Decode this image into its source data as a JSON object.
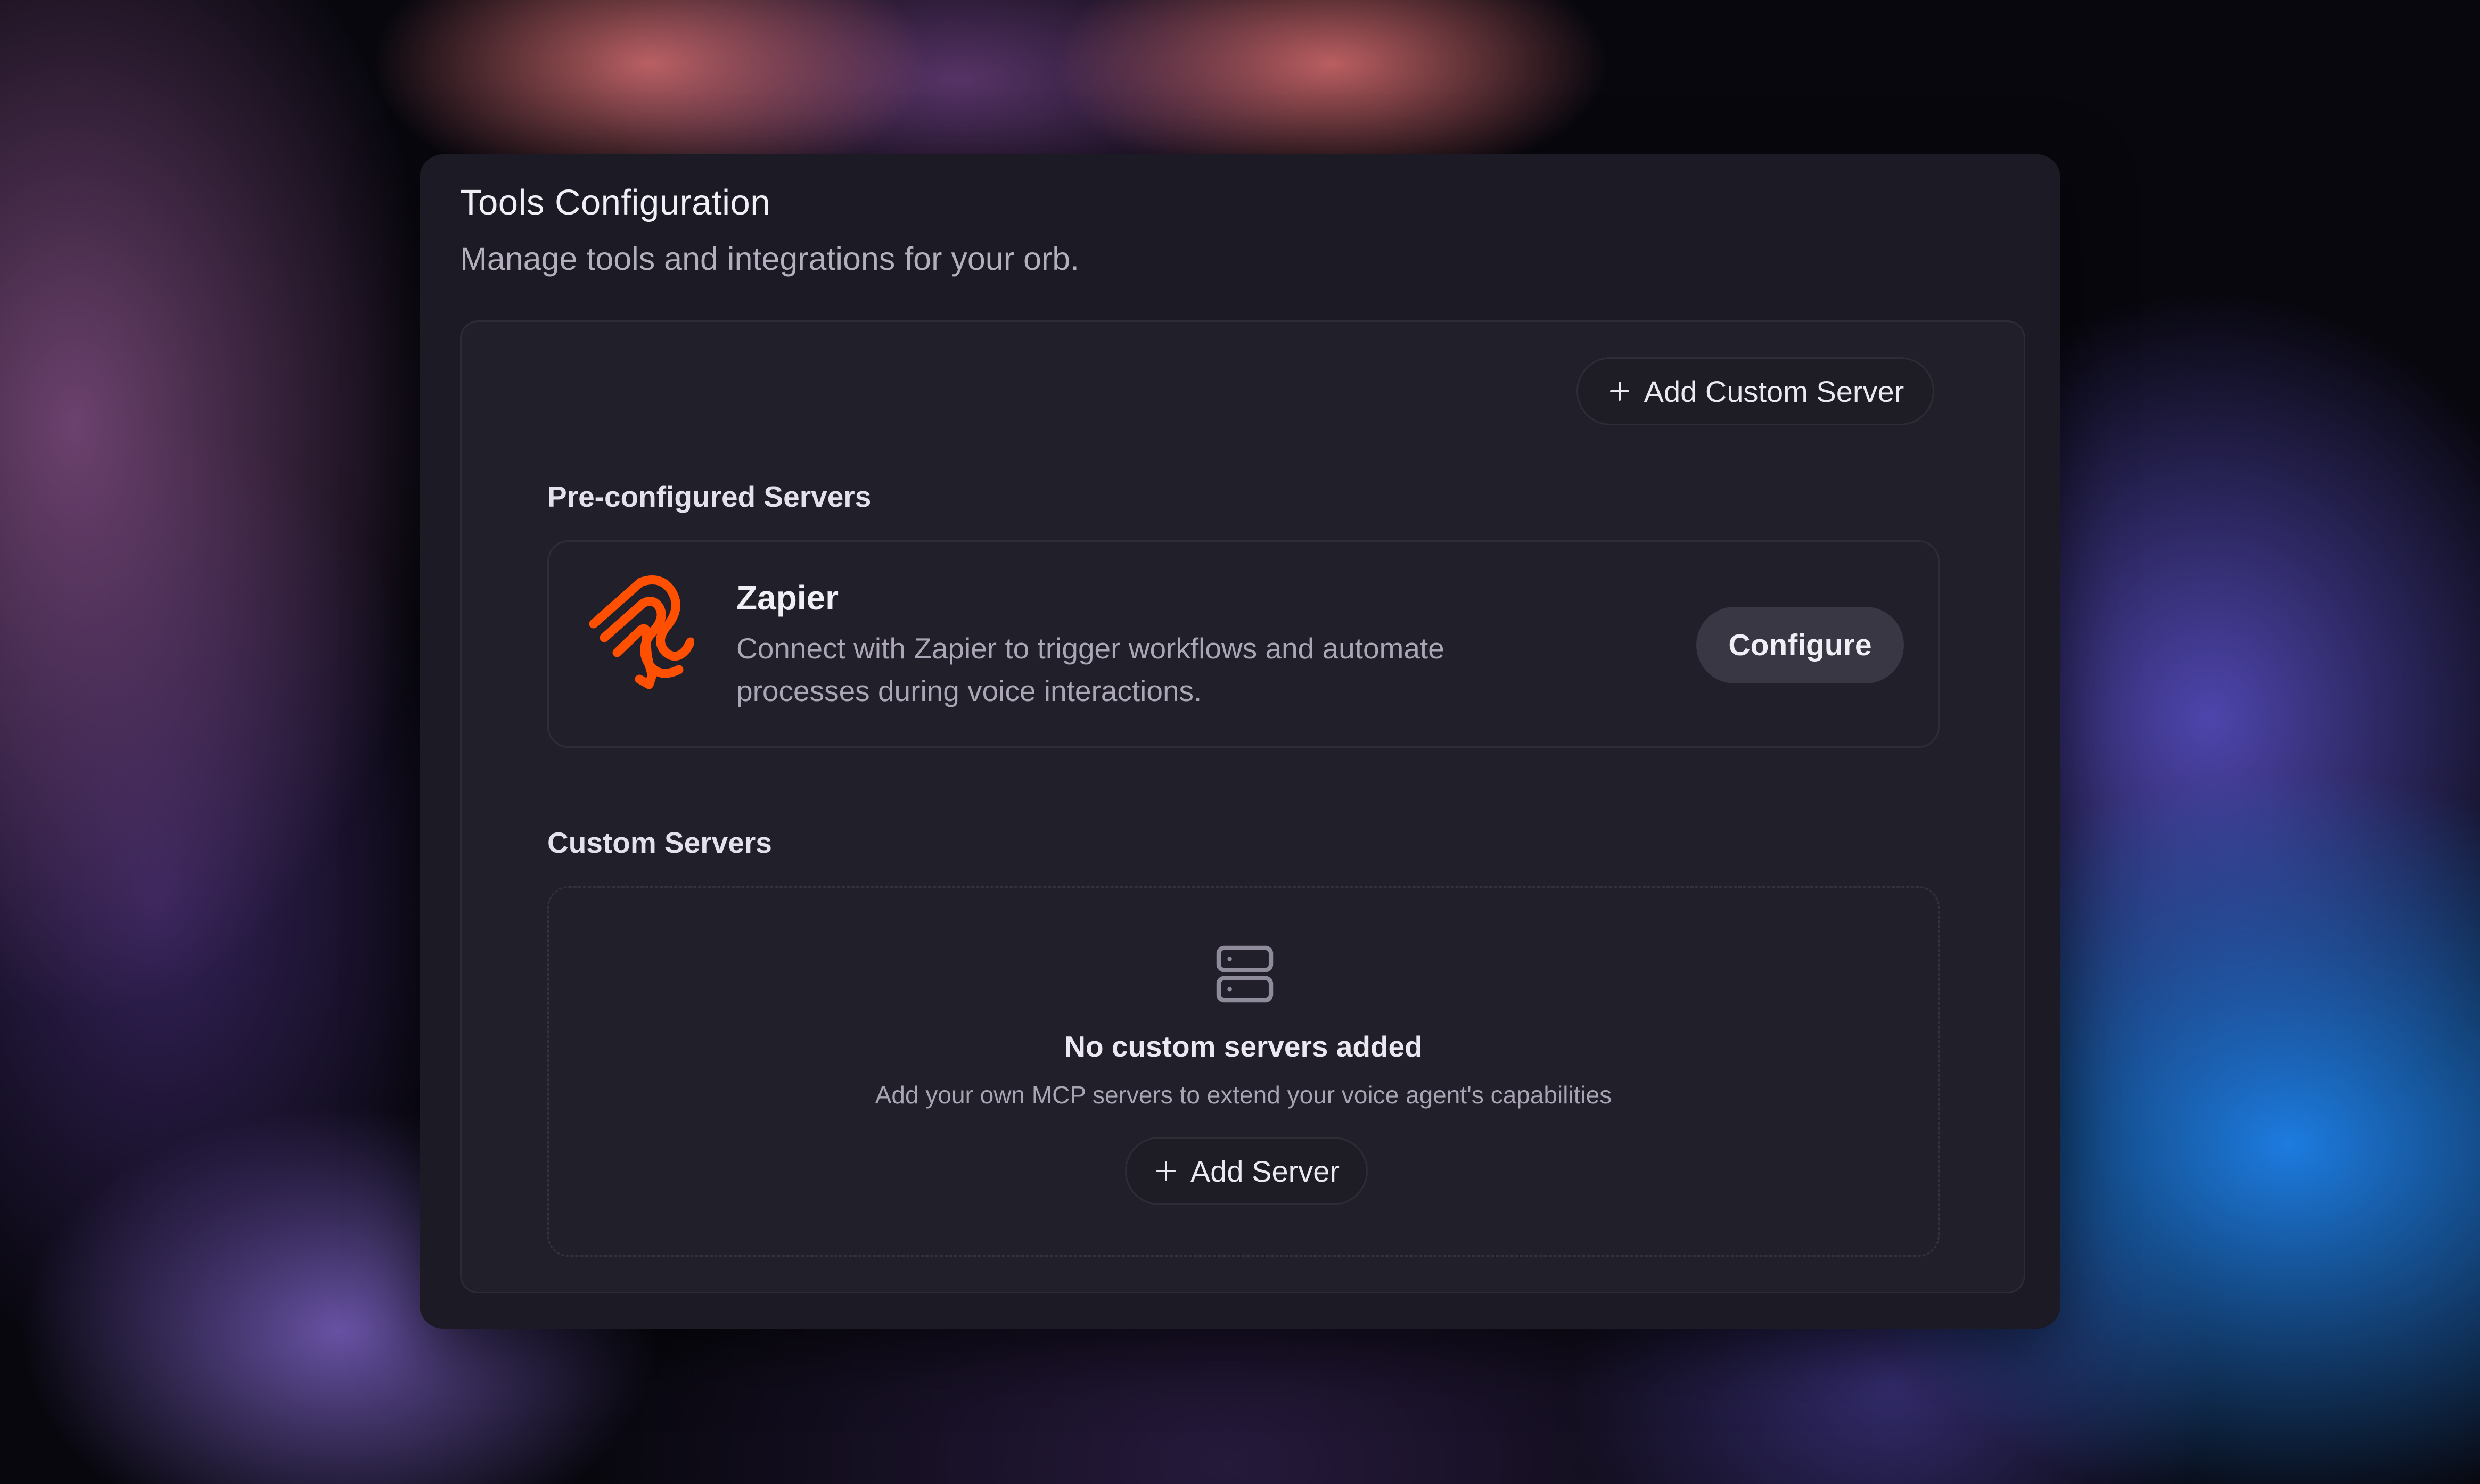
{
  "panel": {
    "title": "Tools Configuration",
    "subtitle": "Manage tools and integrations for your orb."
  },
  "toolbar": {
    "add_custom_server_label": "Add Custom Server",
    "add_custom_server_icon": "plus-icon"
  },
  "preconfigured": {
    "heading": "Pre-configured Servers",
    "servers": [
      {
        "name": "Zapier",
        "description": "Connect with Zapier to trigger workflows and automate processes during voice interactions.",
        "icon": "zapier-logo",
        "action_label": "Configure",
        "brand_color": "#FF4F00"
      }
    ]
  },
  "custom": {
    "heading": "Custom Servers",
    "empty_state": {
      "icon": "server-icon",
      "title": "No custom servers added",
      "description": "Add your own MCP servers to extend your voice agent's capabilities",
      "button_label": "Add Server",
      "button_icon": "plus-icon"
    }
  }
}
